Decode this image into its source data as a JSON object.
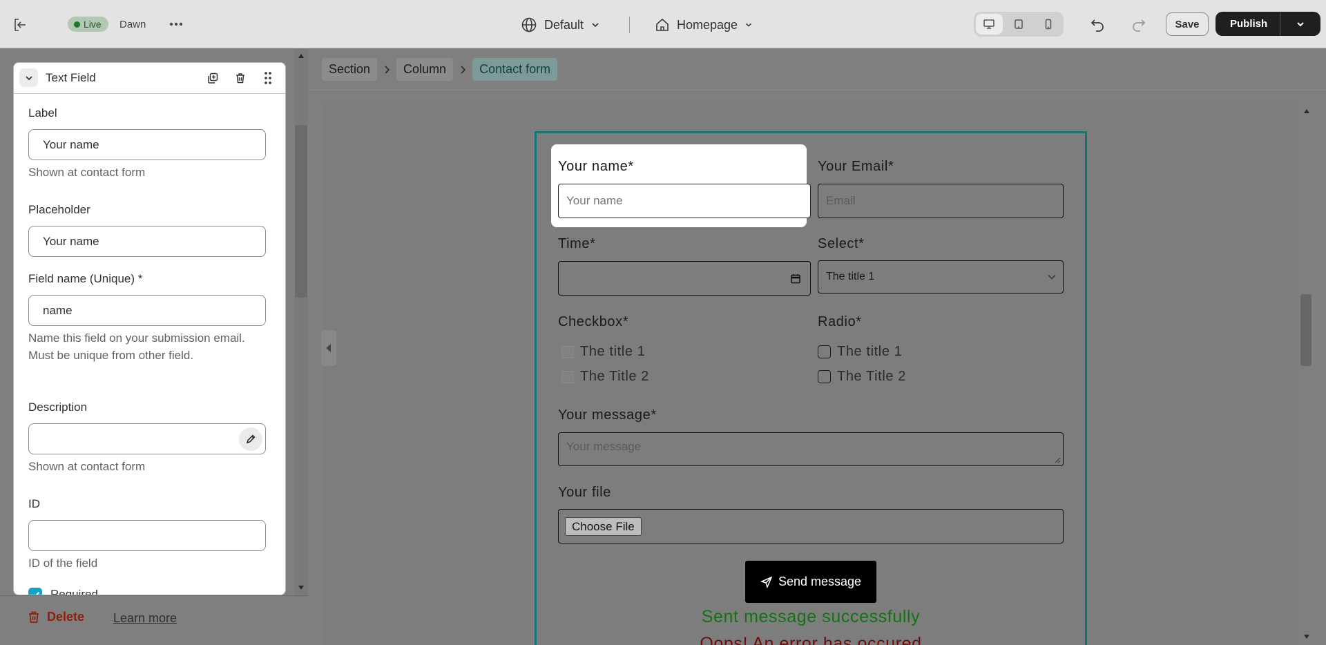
{
  "topbar": {
    "live_label": "Live",
    "theme_name": "Dawn",
    "locale": "Default",
    "page": "Homepage",
    "save_label": "Save",
    "publish_label": "Publish"
  },
  "settings": {
    "title": "Text Field",
    "label_field": {
      "label": "Label",
      "value": "Your name",
      "help": "Shown at contact form"
    },
    "placeholder_field": {
      "label": "Placeholder",
      "value": "Your name"
    },
    "name_field": {
      "label": "Field name (Unique) *",
      "value": "name",
      "help": "Name this field on your submission email. Must be unique from other field."
    },
    "description_field": {
      "label": "Description",
      "value": "",
      "help": "Shown at contact form"
    },
    "id_field": {
      "label": "ID",
      "value": "",
      "help": "ID of the field"
    },
    "required_label": "Required",
    "required_checked": true,
    "delete_label": "Delete",
    "learn_more_label": "Learn more"
  },
  "breadcrumb": [
    "Section",
    "Column",
    "Contact form"
  ],
  "form": {
    "name_label": "Your name*",
    "name_placeholder": "Your name",
    "email_label": "Your Email*",
    "email_placeholder": "Email",
    "time_label": "Time*",
    "select_label": "Select*",
    "select_value": "The title 1",
    "checkbox_label": "Checkbox*",
    "checkbox_options": [
      "The title 1",
      "The Title 2"
    ],
    "radio_label": "Radio*",
    "radio_options": [
      "The title 1",
      "The Title 2"
    ],
    "message_label": "Your message*",
    "message_placeholder": "Your message",
    "file_label": "Your file",
    "choose_file_label": "Choose File",
    "send_label": "Send message",
    "success_message": "Sent message successfully",
    "error_message": "Oops! An error has occured"
  },
  "colors": {
    "accent_teal": "#127676",
    "checkbox_blue": "#16a2c2",
    "success_green": "#137213",
    "error_red": "#6e0d0d",
    "delete_red": "#8e1f0b"
  },
  "icons": [
    "exit-icon",
    "more-icon",
    "globe-icon",
    "home-icon",
    "desktop-icon",
    "tablet-icon",
    "mobile-icon",
    "undo-icon",
    "redo-icon",
    "chevron-down-icon",
    "duplicate-icon",
    "trash-icon",
    "drag-handle-icon",
    "pencil-icon",
    "check-icon",
    "calendar-icon",
    "send-icon"
  ]
}
